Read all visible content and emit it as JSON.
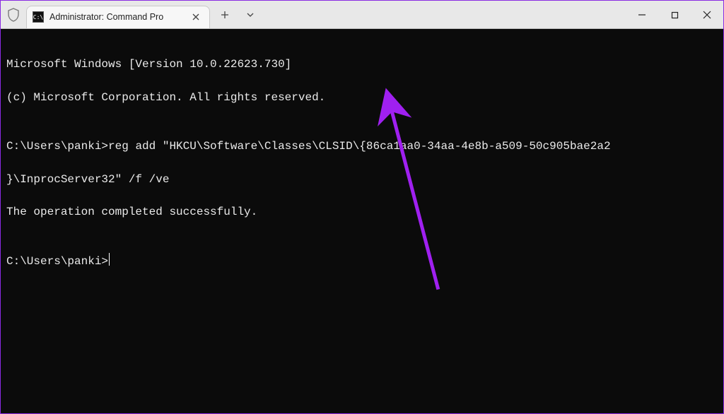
{
  "window": {
    "tab_title": "Administrator: Command Pro",
    "favicon_text": "C:\\"
  },
  "terminal": {
    "line1": "Microsoft Windows [Version 10.0.22623.730]",
    "line2": "(c) Microsoft Corporation. All rights reserved.",
    "blank1": "",
    "prompt1_prefix": "C:\\Users\\panki>",
    "command_part1": "reg add \"HKCU\\Software\\Classes\\CLSID\\{86ca1aa0-34aa-4e8b-a509-50c905bae2a2",
    "command_part2": "}\\InprocServer32\" /f /ve",
    "result": "The operation completed successfully.",
    "blank2": "",
    "prompt2": "C:\\Users\\panki>"
  },
  "colors": {
    "annotation_arrow": "#a020f0"
  }
}
